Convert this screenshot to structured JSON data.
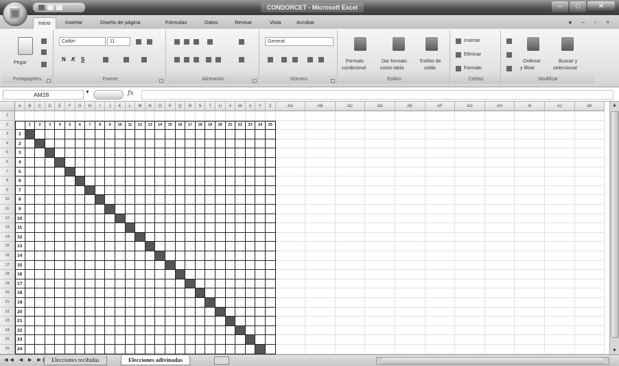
{
  "app": {
    "title": "CONDORCET - Microsoft Excel",
    "colors": {
      "diagonal": "#555555",
      "grid": "#e2e2e2",
      "matrix_border": "#111111"
    }
  },
  "ribbon_tabs": [
    "Inicio",
    "Insertar",
    "Diseño de página",
    "Fórmulas",
    "Datos",
    "Revisar",
    "Vista",
    "Acrobat"
  ],
  "ribbon": {
    "clipboard": {
      "label": "Portapapeles",
      "paste": "Pegar"
    },
    "font": {
      "label": "Fuente",
      "font_name": "Calibri",
      "font_size": "11",
      "bold": "N",
      "italic": "K",
      "underline": "S"
    },
    "alignment": {
      "label": "Alineación"
    },
    "number": {
      "label": "Número",
      "format": "General"
    },
    "styles": {
      "label": "Estilos",
      "cond_format": [
        "Formato",
        "condicional"
      ],
      "as_table": [
        "Dar formato",
        "como tabla"
      ],
      "cell_styles": [
        "Estilos de",
        "celda"
      ]
    },
    "cells": {
      "label": "Celdas",
      "insert": "Insertar",
      "delete": "Eliminar",
      "format": "Formato"
    },
    "editing": {
      "label": "Modificar",
      "sort": [
        "Ordenar",
        "y filtrar"
      ],
      "find": [
        "Buscar y",
        "seleccionar"
      ]
    }
  },
  "formula_bar": {
    "name_box": "AM28",
    "fx": "fx",
    "formula": ""
  },
  "columns_narrow": [
    "A",
    "B",
    "C",
    "D",
    "E",
    "F",
    "G",
    "H",
    "I",
    "J",
    "K",
    "L",
    "M",
    "N",
    "O",
    "P",
    "Q",
    "R",
    "S",
    "T",
    "U",
    "V",
    "W",
    "X",
    "Y",
    "Z"
  ],
  "columns_wide": [
    "AA",
    "AB",
    "AC",
    "AD",
    "AE",
    "AF",
    "AG",
    "AH",
    "AI",
    "AJ",
    "AK"
  ],
  "matrix": {
    "size": 25,
    "header_labels": [
      "1",
      "2",
      "3",
      "4",
      "5",
      "6",
      "7",
      "8",
      "9",
      "10",
      "11",
      "12",
      "13",
      "14",
      "15",
      "16",
      "17",
      "18",
      "19",
      "20",
      "21",
      "22",
      "23",
      "24",
      "25"
    ]
  },
  "sheets": [
    {
      "name": "Elecciones recibidas",
      "active": false
    },
    {
      "name": "Elecciones adivinadas",
      "active": true
    }
  ]
}
